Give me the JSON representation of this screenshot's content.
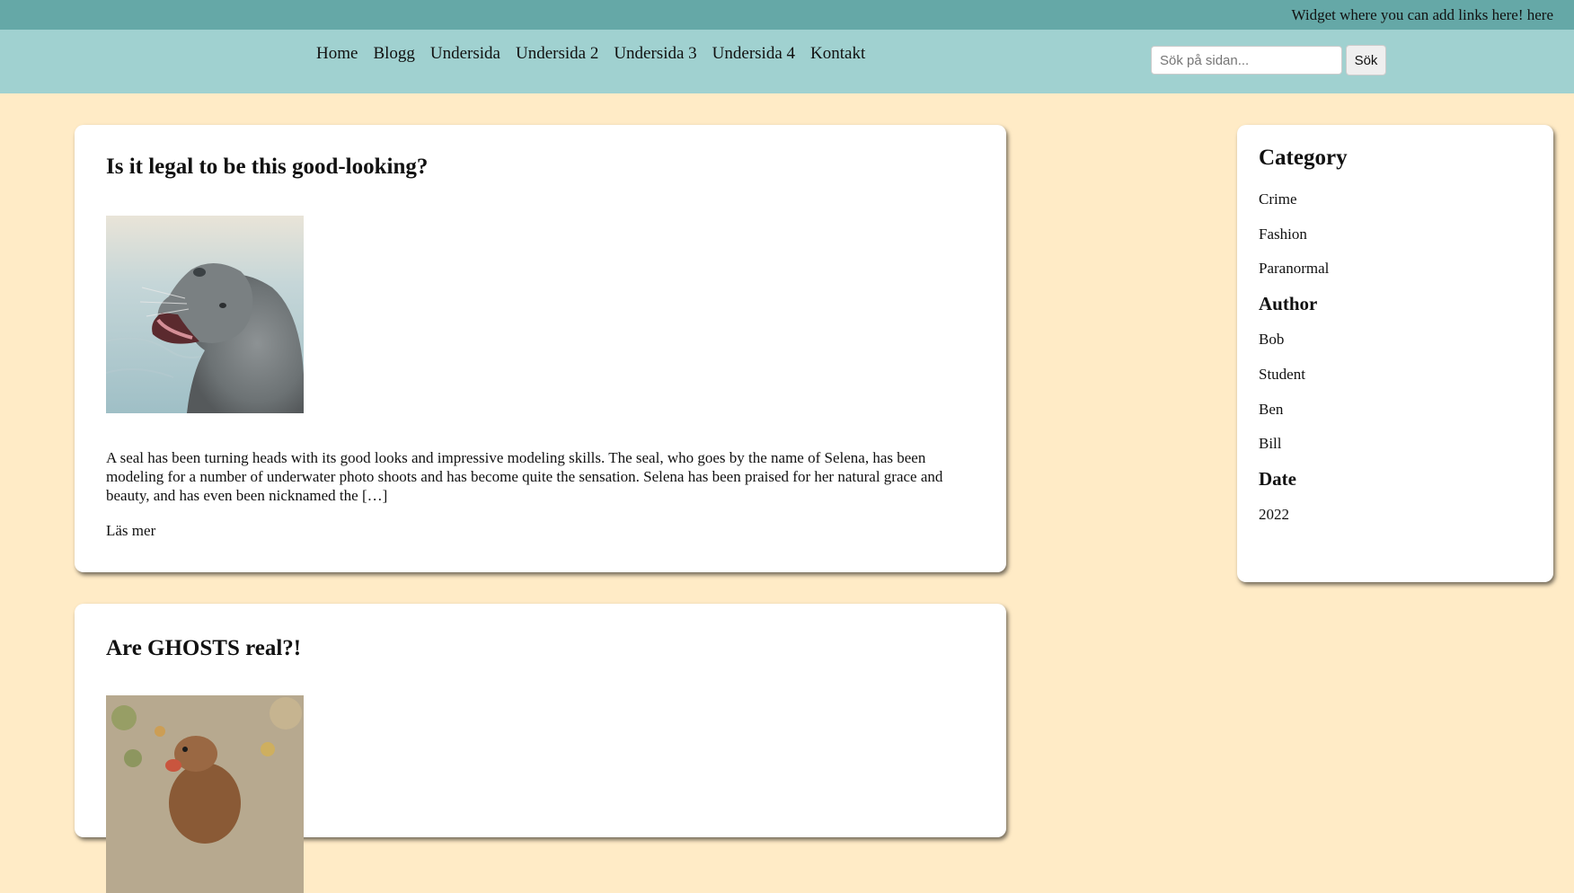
{
  "topbar": {
    "widget_text": "Widget where you can add links here! here"
  },
  "nav": {
    "items": [
      "Home",
      "Blogg",
      "Undersida",
      "Undersida 2",
      "Undersida 3",
      "Undersida 4",
      "Kontakt"
    ]
  },
  "search": {
    "placeholder": "Sök på sidan...",
    "value": "",
    "button_label": "Sök"
  },
  "posts": [
    {
      "title": "Is it legal to be this good-looking?",
      "image": "seal-photo",
      "excerpt": "A seal has been turning heads with its good looks and impressive modeling skills. The seal, who goes by the name of Selena, has been modeling for a number of underwater photo shoots and has become quite the sensation. Selena has been praised for her natural grace and beauty, and has even been nicknamed the […]",
      "read_more": "Läs mer"
    },
    {
      "title": "Are GHOSTS real?!",
      "image": "prairie-dog-photo"
    }
  ],
  "sidebar": {
    "category_heading": "Category",
    "categories": [
      "Crime",
      "Fashion",
      "Paranormal"
    ],
    "author_heading": "Author",
    "authors": [
      "Bob",
      "Student",
      "Ben",
      "Bill"
    ],
    "date_heading": "Date",
    "dates": [
      "2022"
    ]
  },
  "colors": {
    "page_background": "#ffebc6",
    "topbar": "#65a8a7",
    "navbar": "#a0d1d0",
    "card": "#ffffff"
  }
}
